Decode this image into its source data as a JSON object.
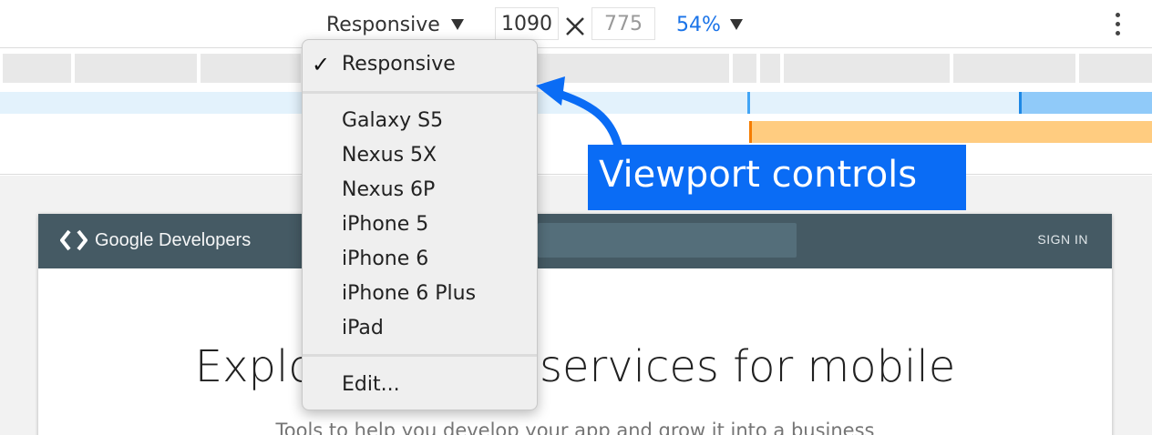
{
  "toolbar": {
    "device_label": "Responsive",
    "width_value": "1090",
    "height_value": "775",
    "zoom_label": "54%"
  },
  "menu": {
    "items": [
      "Responsive",
      "Galaxy S5",
      "Nexus 5X",
      "Nexus 6P",
      "iPhone 5",
      "iPhone 6",
      "iPhone 6 Plus",
      "iPad",
      "Edit..."
    ],
    "selected": "Responsive",
    "check_glyph": "✓"
  },
  "annotation": {
    "label": "Viewport controls",
    "color": "#0a6cf5"
  },
  "page": {
    "logo_text": "Google Developers",
    "signin_label": "SIGN IN",
    "hero_title": "Explore Google services for mobile",
    "hero_subtitle": "Tools to help you develop your app and grow it into a business"
  },
  "colors": {
    "header_bg": "#455a64",
    "zoom_accent": "#1a73e8",
    "media_min": "#90caf9",
    "media_max": "#ffcc80"
  }
}
